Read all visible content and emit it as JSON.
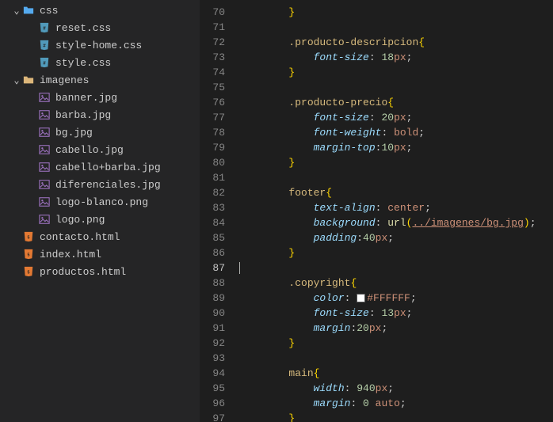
{
  "sidebar": {
    "tree": [
      {
        "type": "folder",
        "label": "css",
        "open": true,
        "indent": 1
      },
      {
        "type": "file",
        "label": "reset.css",
        "icon": "css",
        "indent": 2
      },
      {
        "type": "file",
        "label": "style-home.css",
        "icon": "css",
        "indent": 2
      },
      {
        "type": "file",
        "label": "style.css",
        "icon": "css",
        "indent": 2
      },
      {
        "type": "folder",
        "label": "imagenes",
        "open": true,
        "indent": 1,
        "muted": true
      },
      {
        "type": "file",
        "label": "banner.jpg",
        "icon": "img",
        "indent": 2
      },
      {
        "type": "file",
        "label": "barba.jpg",
        "icon": "img",
        "indent": 2
      },
      {
        "type": "file",
        "label": "bg.jpg",
        "icon": "img",
        "indent": 2
      },
      {
        "type": "file",
        "label": "cabello.jpg",
        "icon": "img",
        "indent": 2
      },
      {
        "type": "file",
        "label": "cabello+barba.jpg",
        "icon": "img",
        "indent": 2
      },
      {
        "type": "file",
        "label": "diferenciales.jpg",
        "icon": "img",
        "indent": 2
      },
      {
        "type": "file",
        "label": "logo-blanco.png",
        "icon": "img",
        "indent": 2
      },
      {
        "type": "file",
        "label": "logo.png",
        "icon": "img",
        "indent": 2
      },
      {
        "type": "file",
        "label": "contacto.html",
        "icon": "html",
        "indent": 1
      },
      {
        "type": "file",
        "label": "index.html",
        "icon": "html",
        "indent": 1
      },
      {
        "type": "file",
        "label": "productos.html",
        "icon": "html",
        "indent": 1
      }
    ]
  },
  "editor": {
    "active_line": 87,
    "lines": [
      {
        "n": 70,
        "t": "        }",
        "tokens": [
          {
            "txt": "        ",
            "cls": ""
          },
          {
            "txt": "}",
            "cls": "tok-brace"
          }
        ]
      },
      {
        "n": 71,
        "t": ""
      },
      {
        "n": 72,
        "tokens": [
          {
            "txt": "        ",
            "cls": ""
          },
          {
            "txt": ".producto-descripcion",
            "cls": "tok-sel"
          },
          {
            "txt": "{",
            "cls": "tok-brace"
          }
        ]
      },
      {
        "n": 73,
        "tokens": [
          {
            "txt": "            ",
            "cls": ""
          },
          {
            "txt": "font-size",
            "cls": "tok-prop"
          },
          {
            "txt": ": ",
            "cls": "tok-punc"
          },
          {
            "txt": "18",
            "cls": "tok-num"
          },
          {
            "txt": "px",
            "cls": "tok-unit"
          },
          {
            "txt": ";",
            "cls": "tok-punc"
          }
        ]
      },
      {
        "n": 74,
        "tokens": [
          {
            "txt": "        ",
            "cls": ""
          },
          {
            "txt": "}",
            "cls": "tok-brace"
          }
        ]
      },
      {
        "n": 75,
        "t": ""
      },
      {
        "n": 76,
        "tokens": [
          {
            "txt": "        ",
            "cls": ""
          },
          {
            "txt": ".producto-precio",
            "cls": "tok-sel"
          },
          {
            "txt": "{",
            "cls": "tok-brace"
          }
        ]
      },
      {
        "n": 77,
        "tokens": [
          {
            "txt": "            ",
            "cls": ""
          },
          {
            "txt": "font-size",
            "cls": "tok-prop"
          },
          {
            "txt": ": ",
            "cls": "tok-punc"
          },
          {
            "txt": "20",
            "cls": "tok-num"
          },
          {
            "txt": "px",
            "cls": "tok-unit"
          },
          {
            "txt": ";",
            "cls": "tok-punc"
          }
        ]
      },
      {
        "n": 78,
        "tokens": [
          {
            "txt": "            ",
            "cls": ""
          },
          {
            "txt": "font-weight",
            "cls": "tok-prop"
          },
          {
            "txt": ": ",
            "cls": "tok-punc"
          },
          {
            "txt": "bold",
            "cls": "tok-val"
          },
          {
            "txt": ";",
            "cls": "tok-punc"
          }
        ]
      },
      {
        "n": 79,
        "tokens": [
          {
            "txt": "            ",
            "cls": ""
          },
          {
            "txt": "margin-top",
            "cls": "tok-prop"
          },
          {
            "txt": ":",
            "cls": "tok-punc"
          },
          {
            "txt": "10",
            "cls": "tok-num"
          },
          {
            "txt": "px",
            "cls": "tok-unit"
          },
          {
            "txt": ";",
            "cls": "tok-punc"
          }
        ]
      },
      {
        "n": 80,
        "tokens": [
          {
            "txt": "        ",
            "cls": ""
          },
          {
            "txt": "}",
            "cls": "tok-brace"
          }
        ]
      },
      {
        "n": 81,
        "t": ""
      },
      {
        "n": 82,
        "tokens": [
          {
            "txt": "        ",
            "cls": ""
          },
          {
            "txt": "footer",
            "cls": "tok-sel"
          },
          {
            "txt": "{",
            "cls": "tok-brace"
          }
        ]
      },
      {
        "n": 83,
        "tokens": [
          {
            "txt": "            ",
            "cls": ""
          },
          {
            "txt": "text-align",
            "cls": "tok-prop"
          },
          {
            "txt": ": ",
            "cls": "tok-punc"
          },
          {
            "txt": "center",
            "cls": "tok-val"
          },
          {
            "txt": ";",
            "cls": "tok-punc"
          }
        ]
      },
      {
        "n": 84,
        "tokens": [
          {
            "txt": "            ",
            "cls": ""
          },
          {
            "txt": "background",
            "cls": "tok-prop"
          },
          {
            "txt": ": ",
            "cls": "tok-punc"
          },
          {
            "txt": "url",
            "cls": "tok-func"
          },
          {
            "txt": "(",
            "cls": "tok-brace"
          },
          {
            "txt": "../imagenes/bg.jpg",
            "cls": "tok-url"
          },
          {
            "txt": ")",
            "cls": "tok-brace"
          },
          {
            "txt": ";",
            "cls": "tok-punc"
          }
        ]
      },
      {
        "n": 85,
        "tokens": [
          {
            "txt": "            ",
            "cls": ""
          },
          {
            "txt": "padding",
            "cls": "tok-prop"
          },
          {
            "txt": ":",
            "cls": "tok-punc"
          },
          {
            "txt": "40",
            "cls": "tok-num"
          },
          {
            "txt": "px",
            "cls": "tok-unit"
          },
          {
            "txt": ";",
            "cls": "tok-punc"
          }
        ]
      },
      {
        "n": 86,
        "tokens": [
          {
            "txt": "        ",
            "cls": ""
          },
          {
            "txt": "}",
            "cls": "tok-brace"
          }
        ]
      },
      {
        "n": 87,
        "t": "",
        "cursor": true
      },
      {
        "n": 88,
        "tokens": [
          {
            "txt": "        ",
            "cls": ""
          },
          {
            "txt": ".copyright",
            "cls": "tok-sel"
          },
          {
            "txt": "{",
            "cls": "tok-brace"
          }
        ]
      },
      {
        "n": 89,
        "tokens": [
          {
            "txt": "            ",
            "cls": ""
          },
          {
            "txt": "color",
            "cls": "tok-prop"
          },
          {
            "txt": ": ",
            "cls": "tok-punc"
          },
          {
            "swatch": true
          },
          {
            "txt": "#FFFFFF",
            "cls": "tok-val"
          },
          {
            "txt": ";",
            "cls": "tok-punc"
          }
        ]
      },
      {
        "n": 90,
        "tokens": [
          {
            "txt": "            ",
            "cls": ""
          },
          {
            "txt": "font-size",
            "cls": "tok-prop"
          },
          {
            "txt": ": ",
            "cls": "tok-punc"
          },
          {
            "txt": "13",
            "cls": "tok-num"
          },
          {
            "txt": "px",
            "cls": "tok-unit"
          },
          {
            "txt": ";",
            "cls": "tok-punc"
          }
        ]
      },
      {
        "n": 91,
        "tokens": [
          {
            "txt": "            ",
            "cls": ""
          },
          {
            "txt": "margin",
            "cls": "tok-prop"
          },
          {
            "txt": ":",
            "cls": "tok-punc"
          },
          {
            "txt": "20",
            "cls": "tok-num"
          },
          {
            "txt": "px",
            "cls": "tok-unit"
          },
          {
            "txt": ";",
            "cls": "tok-punc"
          }
        ]
      },
      {
        "n": 92,
        "tokens": [
          {
            "txt": "        ",
            "cls": ""
          },
          {
            "txt": "}",
            "cls": "tok-brace"
          }
        ]
      },
      {
        "n": 93,
        "t": ""
      },
      {
        "n": 94,
        "tokens": [
          {
            "txt": "        ",
            "cls": ""
          },
          {
            "txt": "main",
            "cls": "tok-sel"
          },
          {
            "txt": "{",
            "cls": "tok-brace"
          }
        ]
      },
      {
        "n": 95,
        "tokens": [
          {
            "txt": "            ",
            "cls": ""
          },
          {
            "txt": "width",
            "cls": "tok-prop"
          },
          {
            "txt": ": ",
            "cls": "tok-punc"
          },
          {
            "txt": "940",
            "cls": "tok-num"
          },
          {
            "txt": "px",
            "cls": "tok-unit"
          },
          {
            "txt": ";",
            "cls": "tok-punc"
          }
        ]
      },
      {
        "n": 96,
        "tokens": [
          {
            "txt": "            ",
            "cls": ""
          },
          {
            "txt": "margin",
            "cls": "tok-prop"
          },
          {
            "txt": ": ",
            "cls": "tok-punc"
          },
          {
            "txt": "0",
            "cls": "tok-num"
          },
          {
            "txt": " ",
            "cls": ""
          },
          {
            "txt": "auto",
            "cls": "tok-val"
          },
          {
            "txt": ";",
            "cls": "tok-punc"
          }
        ]
      },
      {
        "n": 97,
        "tokens": [
          {
            "txt": "        ",
            "cls": ""
          },
          {
            "txt": "}",
            "cls": "tok-brace"
          }
        ]
      }
    ]
  }
}
